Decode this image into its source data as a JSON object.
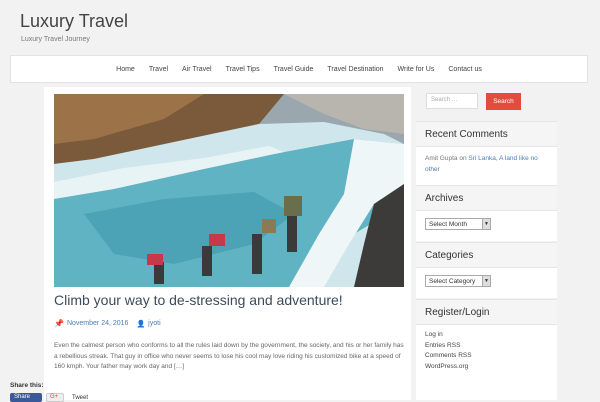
{
  "site": {
    "title": "Luxury Travel",
    "tagline": "Luxury Travel Journey"
  },
  "nav": {
    "items": [
      "Home",
      "Travel",
      "Air Travel",
      "Travel Tips",
      "Travel Guide",
      "Travel Destination",
      "Write for Us",
      "Contact us"
    ]
  },
  "post": {
    "title": "Climb your way to de-stressing and adventure!",
    "date": "November 24, 2016",
    "author": "jyoti",
    "excerpt": "Even the calmest person who conforms to all the rules laid down by the government, the society, and his or her family has a rebellious streak. That guy in office who never seems to lose his cool may love riding his customized bike at a speed of 160 kmph. Your father may work day and […]",
    "share_label": "Share this:",
    "share": {
      "facebook": "Share",
      "gplus": "G+",
      "tweet": "Tweet"
    }
  },
  "sidebar": {
    "search": {
      "placeholder": "Search …",
      "button": "Search"
    },
    "recent_comments": {
      "title": "Recent Comments",
      "author": "Amit Gupta",
      "on": "on",
      "post": "Sri Lanka, A land like no other"
    },
    "archives": {
      "title": "Archives",
      "select": "Select Month"
    },
    "categories": {
      "title": "Categories",
      "select": "Select Category"
    },
    "register": {
      "title": "Register/Login",
      "links": [
        "Log in",
        "Entries RSS",
        "Comments RSS",
        "WordPress.org"
      ]
    }
  },
  "colors": {
    "accent": "#e24c3f",
    "link": "#4b7db4",
    "title": "#3c4b5a"
  }
}
